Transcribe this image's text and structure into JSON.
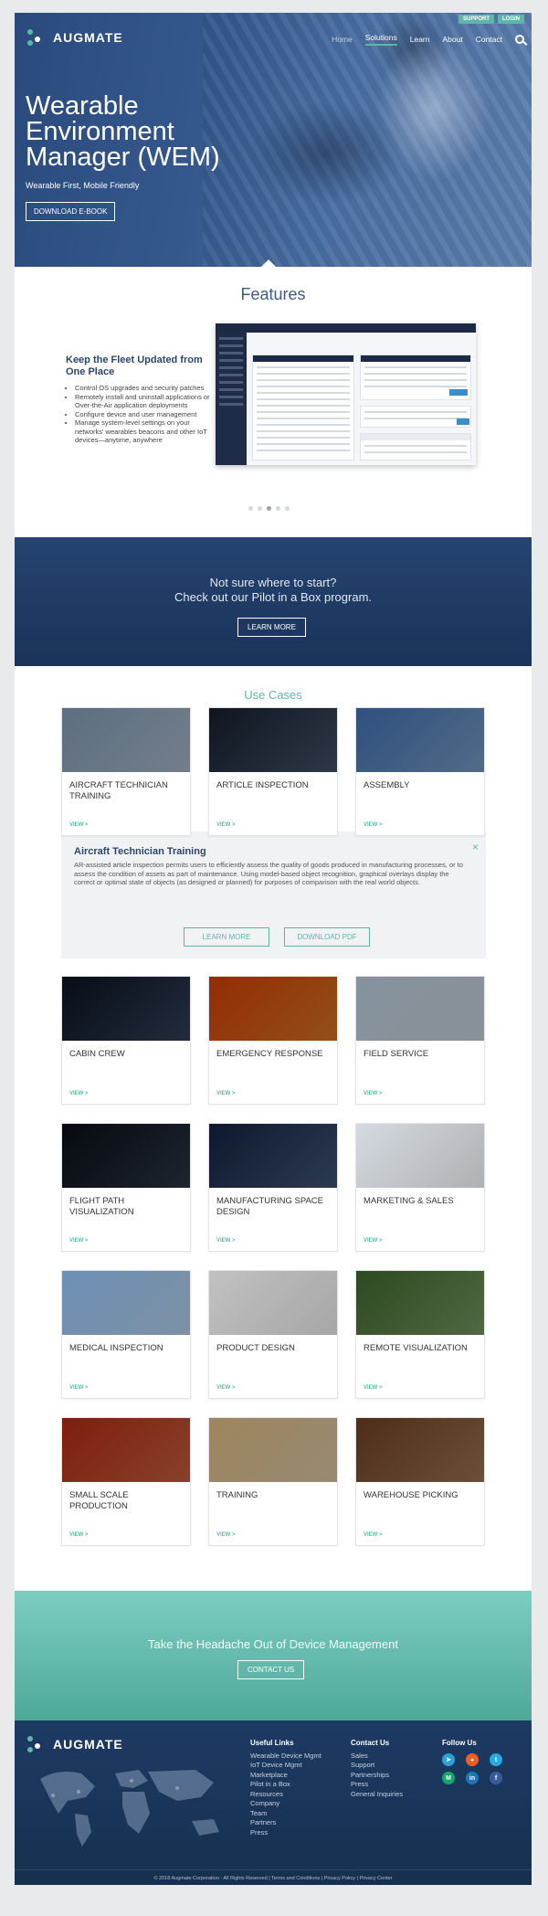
{
  "header": {
    "top_buttons": [
      "SUPPORT",
      "LOGIN"
    ],
    "logo": "AUGMATE",
    "nav": [
      "Home",
      "Solutions",
      "Learn",
      "About",
      "Contact"
    ],
    "hero_title": "Wearable Environment Manager (WEM)",
    "hero_subtitle": "Wearable First, Mobile Friendly",
    "hero_button": "DOWNLOAD E-BOOK"
  },
  "features": {
    "heading": "Features",
    "feature_title": "Keep the Fleet Updated from One Place",
    "bullets": [
      "Control OS upgrades and security patches",
      "Remotely install and uninstall applications or Over-the-Air application deployments",
      "Configure device and user management",
      "Manage system-level settings on your networks' wearables beacons and other IoT devices—anytime, anywhere"
    ],
    "carousel_count": 5,
    "carousel_active": 3
  },
  "pilot": {
    "line1": "Not sure where to start?",
    "line2": "Check out our Pilot in a Box program.",
    "button": "LEARN MORE"
  },
  "usecases": {
    "heading": "Use Cases",
    "view_label": "VIEW >",
    "cards": [
      {
        "title": "Aircraft Technician Training",
        "color": "#9aa8b6"
      },
      {
        "title": "Article Inspection",
        "color": "#3d4a5c"
      },
      {
        "title": "Assembly",
        "color": "#6d8fb4"
      },
      {
        "title": "Cabin Crew",
        "color": "#2d3a4e"
      },
      {
        "title": "Emergency Response",
        "color": "#c26a22"
      },
      {
        "title": "Field Service",
        "color": "#b8c1c9"
      },
      {
        "title": "Flight Path Visualization",
        "color": "#27313f"
      },
      {
        "title": "Manufacturing Space Design",
        "color": "#3b4e6d"
      },
      {
        "title": "Marketing & Sales",
        "color": "#e9ecef"
      },
      {
        "title": "Medical Inspection",
        "color": "#a7c0d8"
      },
      {
        "title": "Product Design",
        "color": "#dedede"
      },
      {
        "title": "Remote Visualization",
        "color": "#6b8a5a"
      },
      {
        "title": "Small Scale Production",
        "color": "#b4573a"
      },
      {
        "title": "Training",
        "color": "#c9b89a"
      },
      {
        "title": "Warehouse Picking",
        "color": "#8e6b4c"
      }
    ],
    "detail": {
      "title": "Aircraft Technician Training",
      "body": "AR-assisted article inspection permits users to efficiently assess the quality of goods produced in manufacturing processes, or to assess the condition of assets as part of maintenance. Using model-based object recognition, graphical overlays display the correct or optimal state of objects (as designed or planned) for purposes of comparison with the real world objects.",
      "learn_more": "LEARN MORE",
      "download": "DOWNLOAD PDF",
      "close": "×"
    }
  },
  "headache": {
    "text": "Take the Headache Out of Device Management",
    "button": "CONTACT US"
  },
  "footer": {
    "logo": "AUGMATE",
    "useful_links_title": "Useful Links",
    "useful_links": [
      "Wearable Device Mgmt",
      "IoT Device Mgmt",
      "Marketplace",
      "Pilot in a Box",
      "Resources",
      "Company",
      "Team",
      "Partners",
      "Press"
    ],
    "contact_title": "Contact Us",
    "contact_links": [
      "Sales",
      "Support",
      "Partnerships",
      "Press",
      "General Inquiries"
    ],
    "follow_title": "Follow Us",
    "social": [
      {
        "name": "telegram-icon",
        "glyph": "➤",
        "color": "#2aa3d8"
      },
      {
        "name": "reddit-icon",
        "glyph": "●",
        "color": "#ff5a1f"
      },
      {
        "name": "twitter-icon",
        "glyph": "t",
        "color": "#29a9e1"
      },
      {
        "name": "medium-icon",
        "glyph": "M",
        "color": "#12a86b"
      },
      {
        "name": "linkedin-icon",
        "glyph": "in",
        "color": "#1c77b5"
      },
      {
        "name": "facebook-icon",
        "glyph": "f",
        "color": "#3c5a99"
      }
    ],
    "copyright": "© 2018 Augmate Corporation - All Rights Reserved | Terms and Conditions | Privacy Policy | Privacy Center"
  }
}
